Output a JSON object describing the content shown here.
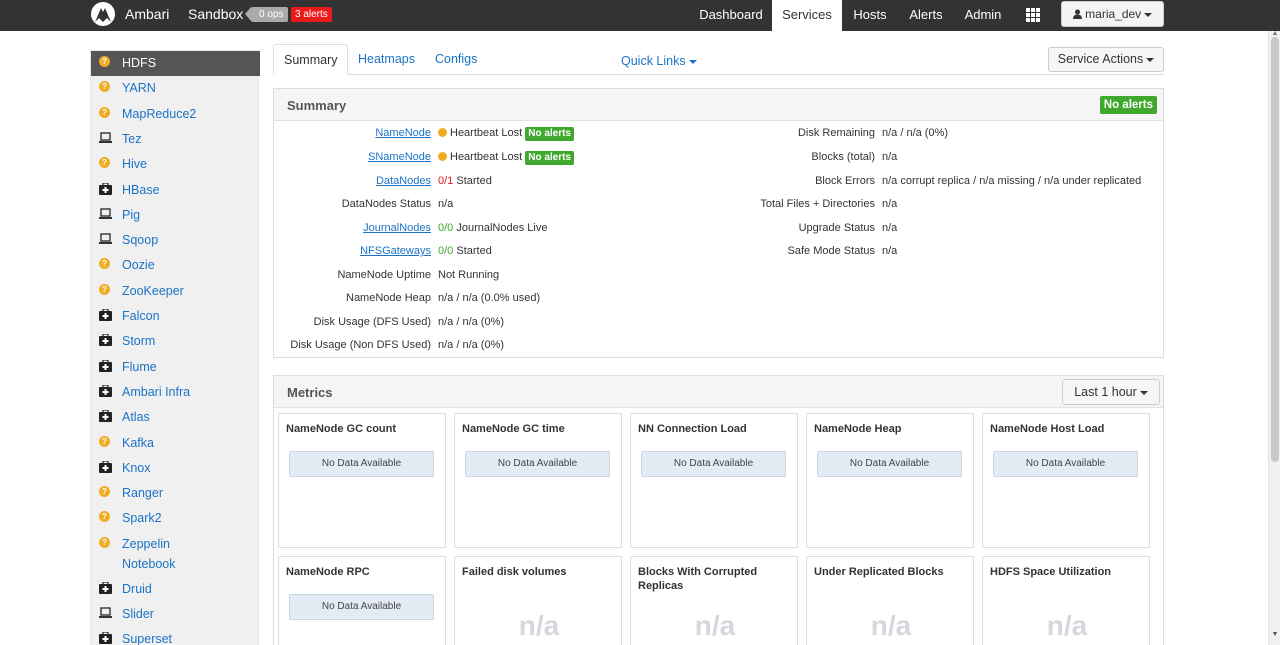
{
  "topbar": {
    "brand": "Ambari",
    "cluster": "Sandbox",
    "ops_badge": "0 ops",
    "alerts_badge": "3 alerts",
    "nav": [
      "Dashboard",
      "Services",
      "Hosts",
      "Alerts",
      "Admin"
    ],
    "user": "maria_dev"
  },
  "sidebar": {
    "items": [
      {
        "label": "HDFS",
        "icon": "warning-icon"
      },
      {
        "label": "YARN",
        "icon": "warning-icon"
      },
      {
        "label": "MapReduce2",
        "icon": "warning-icon"
      },
      {
        "label": "Tez",
        "icon": "laptop-icon"
      },
      {
        "label": "Hive",
        "icon": "warning-icon"
      },
      {
        "label": "HBase",
        "icon": "medkit-icon"
      },
      {
        "label": "Pig",
        "icon": "laptop-icon"
      },
      {
        "label": "Sqoop",
        "icon": "laptop-icon"
      },
      {
        "label": "Oozie",
        "icon": "warning-icon"
      },
      {
        "label": "ZooKeeper",
        "icon": "warning-icon"
      },
      {
        "label": "Falcon",
        "icon": "medkit-icon"
      },
      {
        "label": "Storm",
        "icon": "medkit-icon"
      },
      {
        "label": "Flume",
        "icon": "medkit-icon"
      },
      {
        "label": "Ambari Infra",
        "icon": "medkit-icon"
      },
      {
        "label": "Atlas",
        "icon": "medkit-icon"
      },
      {
        "label": "Kafka",
        "icon": "warning-icon"
      },
      {
        "label": "Knox",
        "icon": "medkit-icon"
      },
      {
        "label": "Ranger",
        "icon": "warning-icon"
      },
      {
        "label": "Spark2",
        "icon": "warning-icon"
      },
      {
        "label": "Zeppelin Notebook",
        "icon": "warning-icon"
      },
      {
        "label": "Druid",
        "icon": "medkit-icon"
      },
      {
        "label": "Slider",
        "icon": "laptop-icon"
      },
      {
        "label": "Superset",
        "icon": "medkit-icon"
      }
    ]
  },
  "tabs": {
    "summary": "Summary",
    "heatmaps": "Heatmaps",
    "configs": "Configs",
    "quick_links": "Quick Links",
    "service_actions": "Service Actions"
  },
  "summary": {
    "title": "Summary",
    "badge": "No alerts",
    "namenode": {
      "label": "NameNode",
      "value": "Heartbeat Lost",
      "badge": "No alerts"
    },
    "snamenode": {
      "label": "SNameNode",
      "value": "Heartbeat Lost",
      "badge": "No alerts"
    },
    "datanodes": {
      "label": "DataNodes",
      "count": "0/1",
      "value": "Started"
    },
    "datanodes_status": {
      "label": "DataNodes Status",
      "value": "n/a"
    },
    "journalnodes": {
      "label": "JournalNodes",
      "count": "0/0",
      "value": "JournalNodes Live"
    },
    "nfsgateways": {
      "label": "NFSGateways",
      "count": "0/0",
      "value": "Started"
    },
    "nn_uptime": {
      "label": "NameNode Uptime",
      "value": "Not Running"
    },
    "nn_heap": {
      "label": "NameNode Heap",
      "value": "n/a / n/a (0.0% used)"
    },
    "disk_dfs": {
      "label": "Disk Usage (DFS Used)",
      "value": "n/a / n/a (0%)"
    },
    "disk_nondfs": {
      "label": "Disk Usage (Non DFS Used)",
      "value": "n/a / n/a (0%)"
    },
    "disk_remaining": {
      "label": "Disk Remaining",
      "value": "n/a / n/a (0%)"
    },
    "blocks_total": {
      "label": "Blocks (total)",
      "value": "n/a"
    },
    "block_errors": {
      "label": "Block Errors",
      "value": "n/a corrupt replica / n/a missing / n/a under replicated"
    },
    "total_files": {
      "label": "Total Files + Directories",
      "value": "n/a"
    },
    "upgrade_status": {
      "label": "Upgrade Status",
      "value": "n/a"
    },
    "safe_mode": {
      "label": "Safe Mode Status",
      "value": "n/a"
    }
  },
  "metrics": {
    "title": "Metrics",
    "time_range": "Last 1 hour",
    "no_data": "No Data Available",
    "na": "n/a",
    "cards": [
      "NameNode GC count",
      "NameNode GC time",
      "NN Connection Load",
      "NameNode Heap",
      "NameNode Host Load",
      "NameNode RPC",
      "Failed disk volumes",
      "Blocks With Corrupted Replicas",
      "Under Replicated Blocks",
      "HDFS Space Utilization"
    ]
  }
}
